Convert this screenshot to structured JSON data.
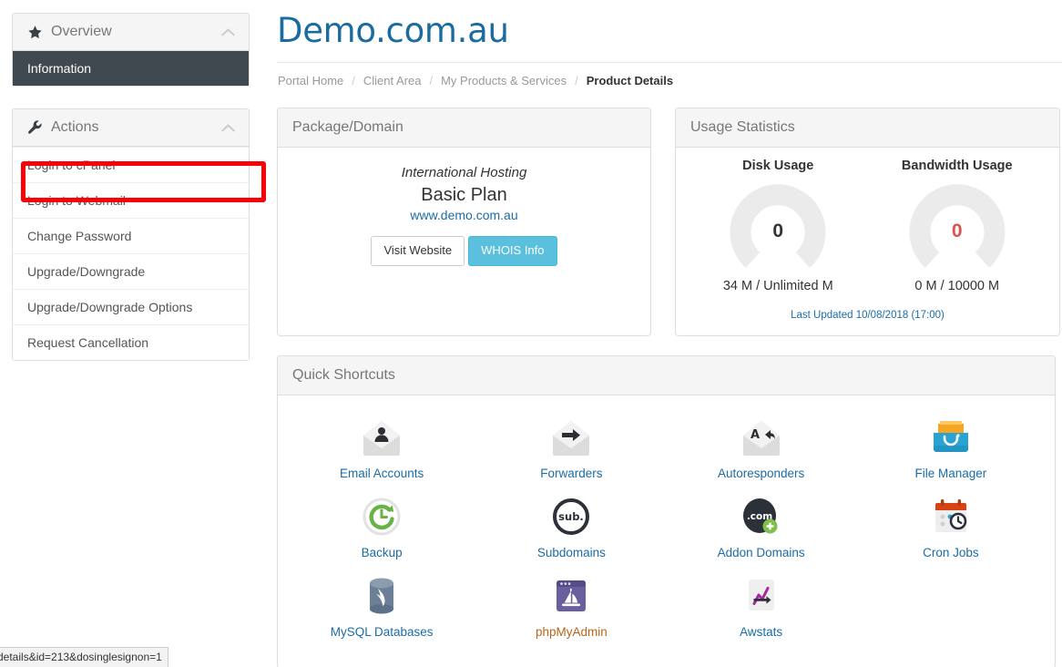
{
  "sidebar": {
    "overview": {
      "title": "Overview",
      "icon": "star-icon",
      "collapse_icon": "chevron-up-icon",
      "items": [
        {
          "label": "Information",
          "active": true
        }
      ]
    },
    "actions": {
      "title": "Actions",
      "icon": "wrench-icon",
      "collapse_icon": "chevron-up-icon",
      "items": [
        {
          "label": "Login to cPanel",
          "highlighted": true
        },
        {
          "label": "Login to Webmail"
        },
        {
          "label": "Change Password"
        },
        {
          "label": "Upgrade/Downgrade"
        },
        {
          "label": "Upgrade/Downgrade Options"
        },
        {
          "label": "Request Cancellation"
        }
      ]
    },
    "annotation_color": "#fb0007"
  },
  "header": {
    "title": "Demo.com.au",
    "title_color": "#1a6ba0",
    "breadcrumb": [
      {
        "label": "Portal Home",
        "active": false
      },
      {
        "label": "Client Area",
        "active": false
      },
      {
        "label": "My Products & Services",
        "active": false
      },
      {
        "label": "Product Details",
        "active": true
      }
    ],
    "breadcrumb_separator": "/"
  },
  "package_card": {
    "heading": "Package/Domain",
    "product_group": "International Hosting",
    "product_name": "Basic Plan",
    "domain": "www.demo.com.au",
    "buttons": [
      {
        "label": "Visit Website",
        "style": "default"
      },
      {
        "label": "WHOIS Info",
        "style": "info",
        "color": "#5bc0de"
      }
    ]
  },
  "usage_card": {
    "heading": "Usage Statistics",
    "last_updated": "Last Updated 10/08/2018 (17:00)",
    "gauges": [
      {
        "title": "Disk Usage",
        "value": "0",
        "value_color": "#333333",
        "caption": "34 M / Unlimited M",
        "used": 34,
        "limit": "Unlimited",
        "percent": 0
      },
      {
        "title": "Bandwidth Usage",
        "value": "0",
        "value_color": "#d9534f",
        "caption": "0 M / 10000 M",
        "used": 0,
        "limit": 10000,
        "percent": 0
      }
    ],
    "gauge_track_color": "#ebebeb"
  },
  "quick_shortcuts": {
    "heading": "Quick Shortcuts",
    "items": [
      {
        "label": "Email Accounts",
        "icon": "email-accounts-icon"
      },
      {
        "label": "Forwarders",
        "icon": "forwarders-icon"
      },
      {
        "label": "Autoresponders",
        "icon": "autoresponders-icon"
      },
      {
        "label": "File Manager",
        "icon": "file-manager-icon"
      },
      {
        "label": "Backup",
        "icon": "backup-icon"
      },
      {
        "label": "Subdomains",
        "icon": "subdomains-icon"
      },
      {
        "label": "Addon Domains",
        "icon": "addon-domains-icon"
      },
      {
        "label": "Cron Jobs",
        "icon": "cron-jobs-icon"
      },
      {
        "label": "MySQL Databases",
        "icon": "mysql-databases-icon"
      },
      {
        "label": "phpMyAdmin",
        "icon": "phpmyadmin-icon"
      },
      {
        "label": "Awstats",
        "icon": "awstats-icon"
      }
    ],
    "subdomain_badge_text": "sub.",
    "addon_badge_text": ".com",
    "link_color": "#1b6ca8"
  },
  "status_bar": {
    "url_text": "details&id=213&dosinglesignon=1"
  }
}
